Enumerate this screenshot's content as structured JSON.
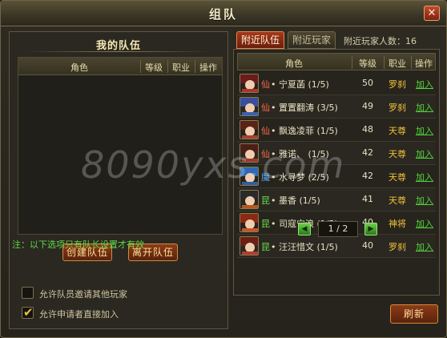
{
  "window": {
    "title": "组队",
    "close_icon": "✕"
  },
  "my_team": {
    "title": "我的队伍",
    "columns": [
      "角色",
      "等级",
      "职业",
      "操作"
    ],
    "rows": [],
    "create_label": "创建队伍",
    "leave_label": "离开队伍",
    "note": "注：以下选项只有队长设置才有效",
    "options": [
      {
        "label": "允许队员邀请其他玩家",
        "checked": false
      },
      {
        "label": "允许申请者直接加入",
        "checked": true
      }
    ]
  },
  "nearby": {
    "tabs": [
      {
        "label": "附近队伍",
        "active": true
      },
      {
        "label": "附近玩家",
        "active": false
      }
    ],
    "count_label": "附近玩家人数：16",
    "columns": [
      "角色",
      "等级",
      "职业",
      "操作"
    ],
    "rows": [
      {
        "sect": "仙",
        "name": "• 宁夏菡 (1/5)",
        "level": "50",
        "job": "罗刹",
        "action": "加入"
      },
      {
        "sect": "仙",
        "name": "• 置置翻涛 (3/5)",
        "level": "49",
        "job": "罗刹",
        "action": "加入"
      },
      {
        "sect": "仙",
        "name": "• 飘逸凌菲 (1/5)",
        "level": "48",
        "job": "天尊",
        "action": "加入"
      },
      {
        "sect": "仙",
        "name": "• 雅诺、 (1/5)",
        "level": "42",
        "job": "天尊",
        "action": "加入"
      },
      {
        "sect": "魔",
        "name": "• 水寻梦 (2/5)",
        "level": "42",
        "job": "天尊",
        "action": "加入"
      },
      {
        "sect": "昆",
        "name": "• 墨香 (1/5)",
        "level": "41",
        "job": "天尊",
        "action": "加入"
      },
      {
        "sect": "昆",
        "name": "• 司寇宁浪 (1/5)",
        "level": "40",
        "job": "神将",
        "action": "加入"
      },
      {
        "sect": "昆",
        "name": "• 汪汪惜文 (1/5)",
        "level": "40",
        "job": "罗刹",
        "action": "加入"
      }
    ],
    "pager": {
      "text": "1 / 2",
      "prev_icon": "◀",
      "next_icon": "▶"
    },
    "refresh_label": "刷新"
  },
  "watermark": "8090yxs.com",
  "colors": {
    "sect_xian": "#ff6a4a",
    "sect_mo": "#52a8ff",
    "sect_kun": "#6de04e",
    "join": "#52d63a",
    "job": "#f0c23a"
  }
}
